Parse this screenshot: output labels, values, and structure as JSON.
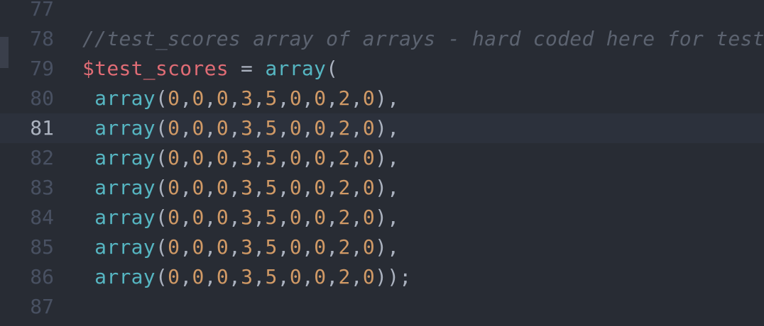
{
  "editor": {
    "colors": {
      "background": "#282c34",
      "active_line": "#2c313c",
      "gutter_text": "#495162",
      "comment": "#5c6370",
      "variable": "#e06c75",
      "function": "#56b6c2",
      "number": "#d19a66",
      "plain": "#abb2bf"
    },
    "active_line_number": "81",
    "lines": [
      {
        "number": "77",
        "tokens": []
      },
      {
        "number": "78",
        "tokens": [
          {
            "t": "comment",
            "text": "//test_scores array of arrays - hard coded here for testing"
          }
        ]
      },
      {
        "number": "79",
        "tokens": [
          {
            "t": "var",
            "text": "$test_scores"
          },
          {
            "t": "op",
            "text": " = "
          },
          {
            "t": "fn",
            "text": "array"
          },
          {
            "t": "punct",
            "text": "("
          }
        ]
      },
      {
        "number": "80",
        "tokens": [
          {
            "t": "op",
            "text": " "
          },
          {
            "t": "fn",
            "text": "array"
          },
          {
            "t": "punct",
            "text": "("
          },
          {
            "t": "num",
            "text": "0"
          },
          {
            "t": "punct",
            "text": ","
          },
          {
            "t": "num",
            "text": "0"
          },
          {
            "t": "punct",
            "text": ","
          },
          {
            "t": "num",
            "text": "0"
          },
          {
            "t": "punct",
            "text": ","
          },
          {
            "t": "num",
            "text": "3"
          },
          {
            "t": "punct",
            "text": ","
          },
          {
            "t": "num",
            "text": "5"
          },
          {
            "t": "punct",
            "text": ","
          },
          {
            "t": "num",
            "text": "0"
          },
          {
            "t": "punct",
            "text": ","
          },
          {
            "t": "num",
            "text": "0"
          },
          {
            "t": "punct",
            "text": ","
          },
          {
            "t": "num",
            "text": "2"
          },
          {
            "t": "punct",
            "text": ","
          },
          {
            "t": "num",
            "text": "0"
          },
          {
            "t": "punct",
            "text": "),"
          }
        ]
      },
      {
        "number": "81",
        "tokens": [
          {
            "t": "op",
            "text": " "
          },
          {
            "t": "fn",
            "text": "array"
          },
          {
            "t": "punct",
            "text": "("
          },
          {
            "t": "num",
            "text": "0"
          },
          {
            "t": "punct",
            "text": ","
          },
          {
            "t": "num",
            "text": "0"
          },
          {
            "t": "punct",
            "text": ","
          },
          {
            "t": "num",
            "text": "0"
          },
          {
            "t": "punct",
            "text": ","
          },
          {
            "t": "num",
            "text": "3"
          },
          {
            "t": "punct",
            "text": ","
          },
          {
            "t": "num",
            "text": "5"
          },
          {
            "t": "punct",
            "text": ","
          },
          {
            "t": "num",
            "text": "0"
          },
          {
            "t": "punct",
            "text": ","
          },
          {
            "t": "num",
            "text": "0"
          },
          {
            "t": "punct",
            "text": ","
          },
          {
            "t": "num",
            "text": "2"
          },
          {
            "t": "punct",
            "text": ","
          },
          {
            "t": "num",
            "text": "0"
          },
          {
            "t": "punct",
            "text": "),"
          }
        ]
      },
      {
        "number": "82",
        "tokens": [
          {
            "t": "op",
            "text": " "
          },
          {
            "t": "fn",
            "text": "array"
          },
          {
            "t": "punct",
            "text": "("
          },
          {
            "t": "num",
            "text": "0"
          },
          {
            "t": "punct",
            "text": ","
          },
          {
            "t": "num",
            "text": "0"
          },
          {
            "t": "punct",
            "text": ","
          },
          {
            "t": "num",
            "text": "0"
          },
          {
            "t": "punct",
            "text": ","
          },
          {
            "t": "num",
            "text": "3"
          },
          {
            "t": "punct",
            "text": ","
          },
          {
            "t": "num",
            "text": "5"
          },
          {
            "t": "punct",
            "text": ","
          },
          {
            "t": "num",
            "text": "0"
          },
          {
            "t": "punct",
            "text": ","
          },
          {
            "t": "num",
            "text": "0"
          },
          {
            "t": "punct",
            "text": ","
          },
          {
            "t": "num",
            "text": "2"
          },
          {
            "t": "punct",
            "text": ","
          },
          {
            "t": "num",
            "text": "0"
          },
          {
            "t": "punct",
            "text": "),"
          }
        ]
      },
      {
        "number": "83",
        "tokens": [
          {
            "t": "op",
            "text": " "
          },
          {
            "t": "fn",
            "text": "array"
          },
          {
            "t": "punct",
            "text": "("
          },
          {
            "t": "num",
            "text": "0"
          },
          {
            "t": "punct",
            "text": ","
          },
          {
            "t": "num",
            "text": "0"
          },
          {
            "t": "punct",
            "text": ","
          },
          {
            "t": "num",
            "text": "0"
          },
          {
            "t": "punct",
            "text": ","
          },
          {
            "t": "num",
            "text": "3"
          },
          {
            "t": "punct",
            "text": ","
          },
          {
            "t": "num",
            "text": "5"
          },
          {
            "t": "punct",
            "text": ","
          },
          {
            "t": "num",
            "text": "0"
          },
          {
            "t": "punct",
            "text": ","
          },
          {
            "t": "num",
            "text": "0"
          },
          {
            "t": "punct",
            "text": ","
          },
          {
            "t": "num",
            "text": "2"
          },
          {
            "t": "punct",
            "text": ","
          },
          {
            "t": "num",
            "text": "0"
          },
          {
            "t": "punct",
            "text": "),"
          }
        ]
      },
      {
        "number": "84",
        "tokens": [
          {
            "t": "op",
            "text": " "
          },
          {
            "t": "fn",
            "text": "array"
          },
          {
            "t": "punct",
            "text": "("
          },
          {
            "t": "num",
            "text": "0"
          },
          {
            "t": "punct",
            "text": ","
          },
          {
            "t": "num",
            "text": "0"
          },
          {
            "t": "punct",
            "text": ","
          },
          {
            "t": "num",
            "text": "0"
          },
          {
            "t": "punct",
            "text": ","
          },
          {
            "t": "num",
            "text": "3"
          },
          {
            "t": "punct",
            "text": ","
          },
          {
            "t": "num",
            "text": "5"
          },
          {
            "t": "punct",
            "text": ","
          },
          {
            "t": "num",
            "text": "0"
          },
          {
            "t": "punct",
            "text": ","
          },
          {
            "t": "num",
            "text": "0"
          },
          {
            "t": "punct",
            "text": ","
          },
          {
            "t": "num",
            "text": "2"
          },
          {
            "t": "punct",
            "text": ","
          },
          {
            "t": "num",
            "text": "0"
          },
          {
            "t": "punct",
            "text": "),"
          }
        ]
      },
      {
        "number": "85",
        "tokens": [
          {
            "t": "op",
            "text": " "
          },
          {
            "t": "fn",
            "text": "array"
          },
          {
            "t": "punct",
            "text": "("
          },
          {
            "t": "num",
            "text": "0"
          },
          {
            "t": "punct",
            "text": ","
          },
          {
            "t": "num",
            "text": "0"
          },
          {
            "t": "punct",
            "text": ","
          },
          {
            "t": "num",
            "text": "0"
          },
          {
            "t": "punct",
            "text": ","
          },
          {
            "t": "num",
            "text": "3"
          },
          {
            "t": "punct",
            "text": ","
          },
          {
            "t": "num",
            "text": "5"
          },
          {
            "t": "punct",
            "text": ","
          },
          {
            "t": "num",
            "text": "0"
          },
          {
            "t": "punct",
            "text": ","
          },
          {
            "t": "num",
            "text": "0"
          },
          {
            "t": "punct",
            "text": ","
          },
          {
            "t": "num",
            "text": "2"
          },
          {
            "t": "punct",
            "text": ","
          },
          {
            "t": "num",
            "text": "0"
          },
          {
            "t": "punct",
            "text": "),"
          }
        ]
      },
      {
        "number": "86",
        "tokens": [
          {
            "t": "op",
            "text": " "
          },
          {
            "t": "fn",
            "text": "array"
          },
          {
            "t": "punct",
            "text": "("
          },
          {
            "t": "num",
            "text": "0"
          },
          {
            "t": "punct",
            "text": ","
          },
          {
            "t": "num",
            "text": "0"
          },
          {
            "t": "punct",
            "text": ","
          },
          {
            "t": "num",
            "text": "0"
          },
          {
            "t": "punct",
            "text": ","
          },
          {
            "t": "num",
            "text": "3"
          },
          {
            "t": "punct",
            "text": ","
          },
          {
            "t": "num",
            "text": "5"
          },
          {
            "t": "punct",
            "text": ","
          },
          {
            "t": "num",
            "text": "0"
          },
          {
            "t": "punct",
            "text": ","
          },
          {
            "t": "num",
            "text": "0"
          },
          {
            "t": "punct",
            "text": ","
          },
          {
            "t": "num",
            "text": "2"
          },
          {
            "t": "punct",
            "text": ","
          },
          {
            "t": "num",
            "text": "0"
          },
          {
            "t": "punct",
            "text": "));"
          }
        ]
      },
      {
        "number": "87",
        "tokens": []
      }
    ]
  }
}
